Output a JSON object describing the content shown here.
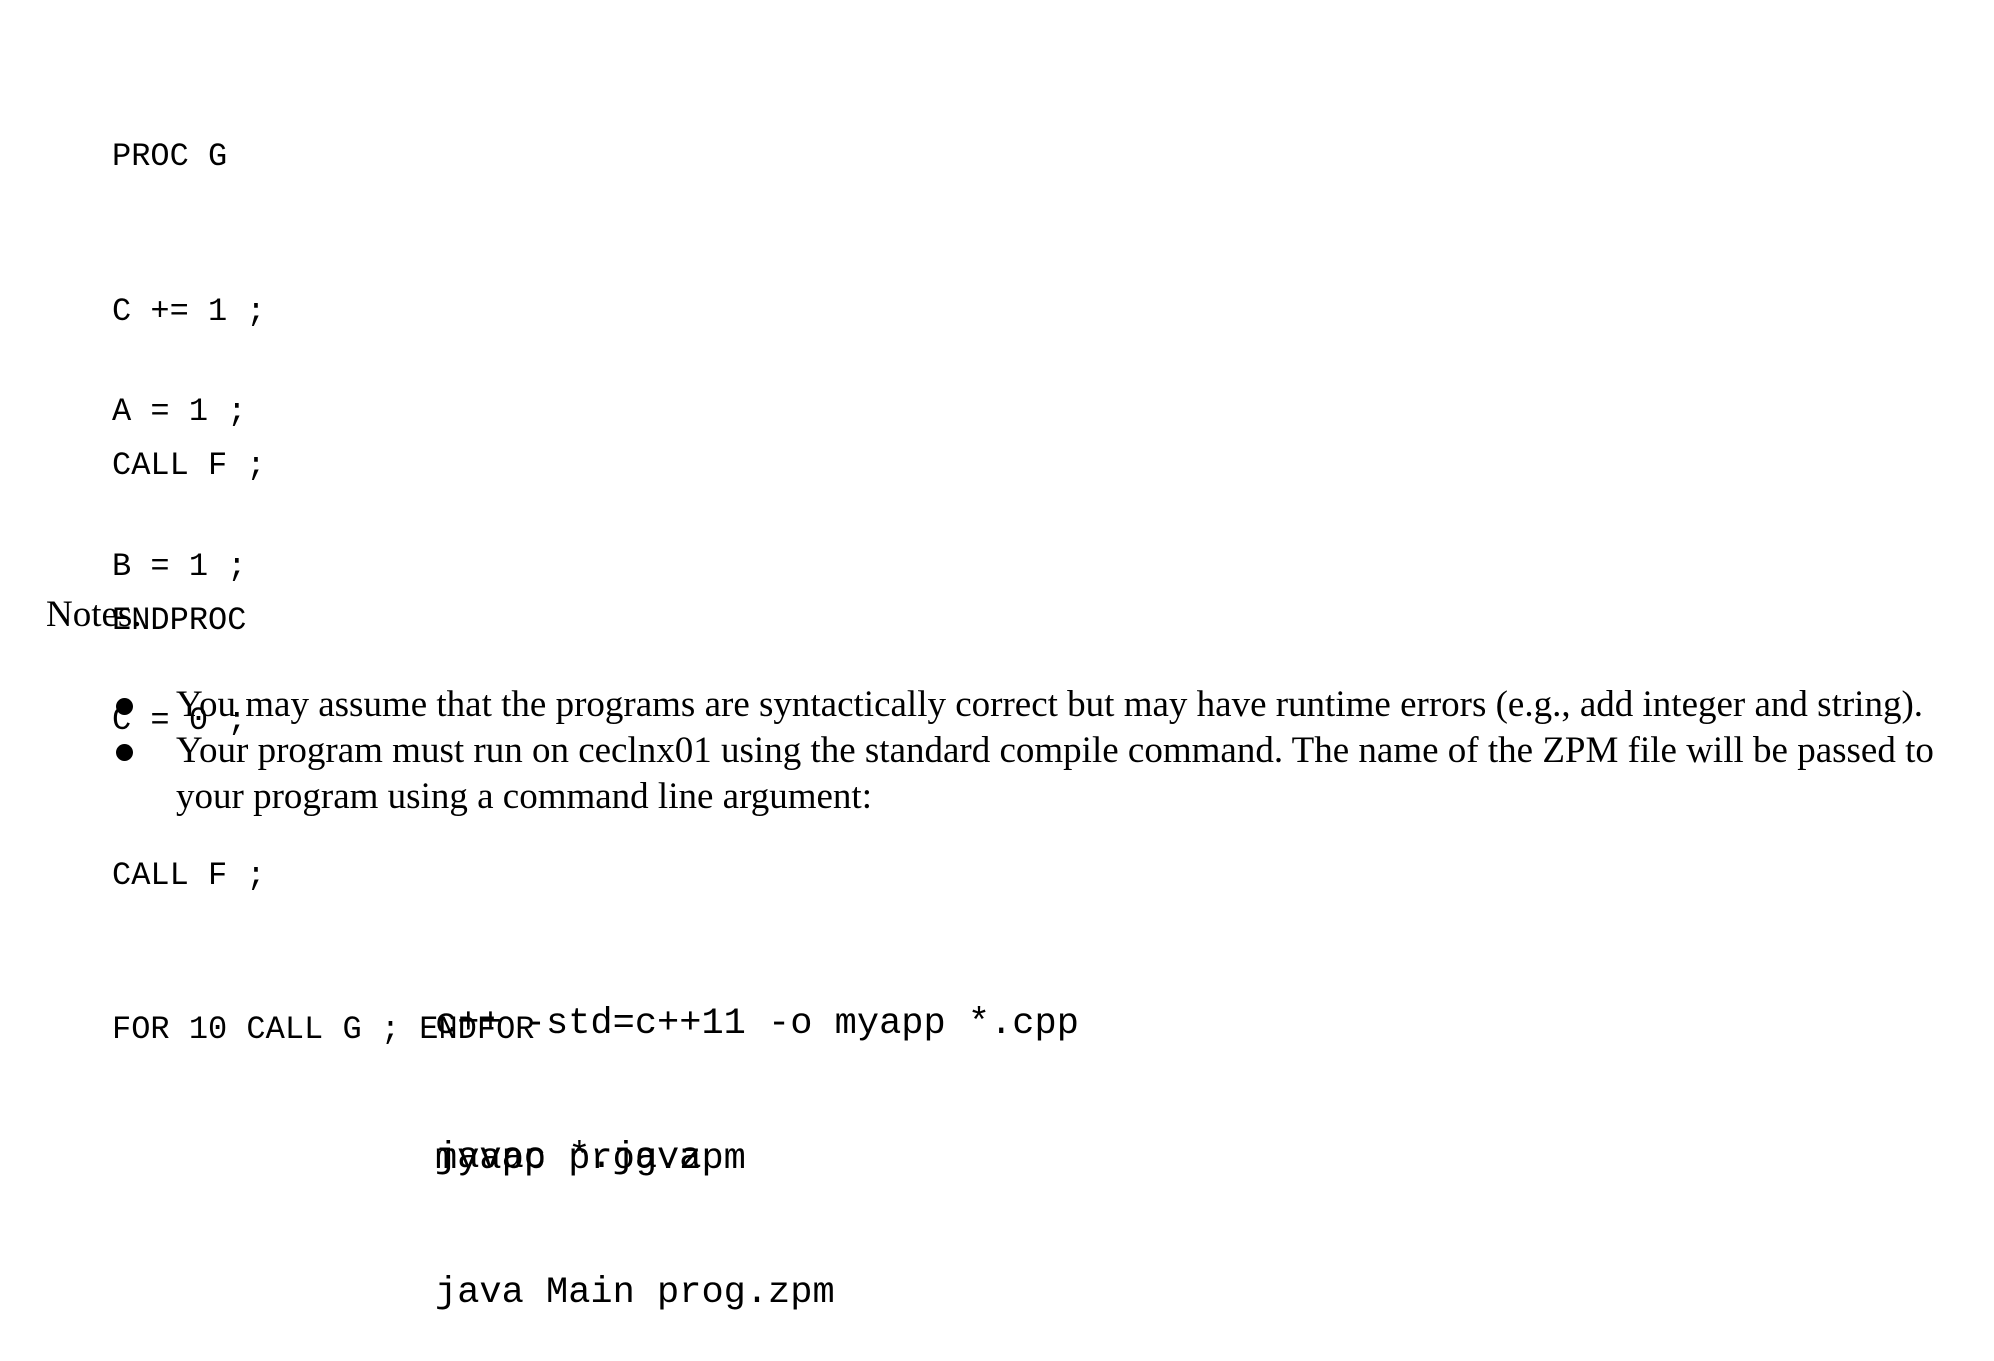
{
  "code": {
    "proc_block": [
      "PROC G",
      "C += 1 ;",
      "CALL F ;",
      "ENDPROC"
    ],
    "main_block": [
      "A = 1 ;",
      "B = 1 ;",
      "C = 0 ;",
      "CALL F ;",
      "FOR 10 CALL G ; ENDFOR"
    ]
  },
  "notes": {
    "heading": "Notes.",
    "items": [
      "You may assume that the programs are syntactically correct but may have runtime errors (e.g., add integer and string).",
      "Your program must run on ceclnx01 using the standard compile command. The name of the ZPM file will be passed to your program using a command line argument:"
    ]
  },
  "commands": {
    "cpp": [
      "c++ -std=c++11 -o myapp *.cpp",
      "myapp prog.zpm"
    ],
    "java": [
      "javac *.java",
      "java Main prog.zpm"
    ]
  }
}
